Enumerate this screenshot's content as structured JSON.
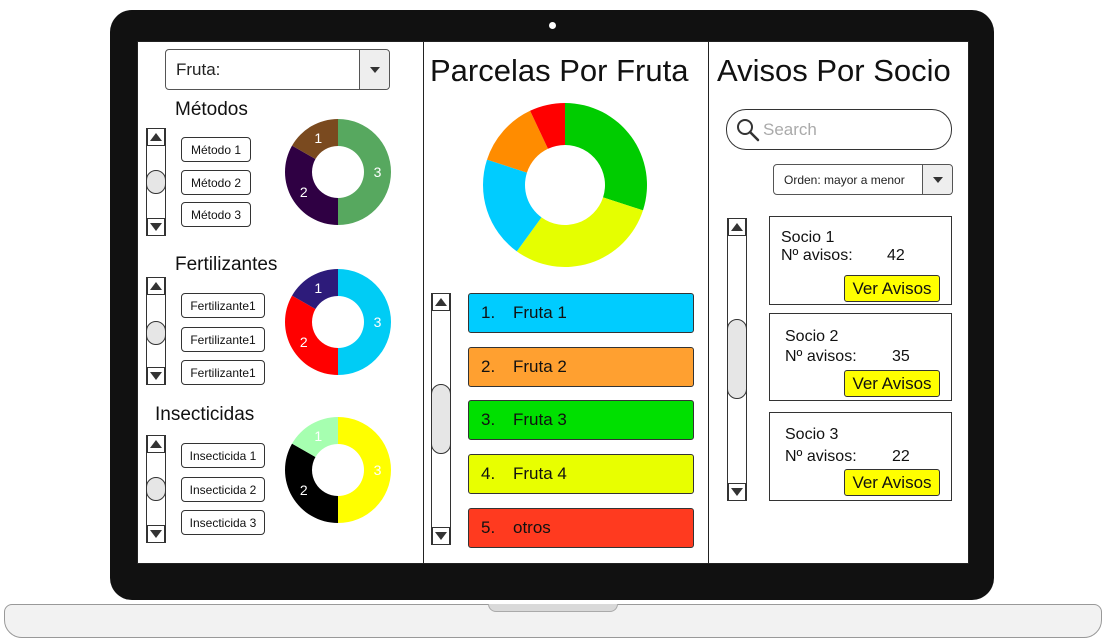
{
  "colors": {
    "metodo": [
      "#57a85f",
      "#2f0043",
      "#7a4a1f"
    ],
    "fertilizante": [
      "#00ccf5",
      "#ff0000",
      "#2d1b7a"
    ],
    "insecticida": [
      "#ffff00",
      "#000000",
      "#a6ffb0"
    ],
    "fruit": [
      "#00cc00",
      "#e5ff00",
      "#00ccff",
      "#ff8c00",
      "#ff0000"
    ],
    "fruit_items": [
      "#00ccff",
      "#ffa030",
      "#00e000",
      "#e8ff00",
      "#ff3a1f"
    ],
    "ver_button": "#ffff00"
  },
  "left": {
    "fruit_select": {
      "value": "Fruta:"
    },
    "metodos": {
      "title": "Métodos",
      "buttons": [
        "Método 1",
        "Método 2",
        "Método 3"
      ],
      "donut": [
        {
          "label": "3",
          "value": 50
        },
        {
          "label": "2",
          "value": 33.3
        },
        {
          "label": "1",
          "value": 16.7
        }
      ]
    },
    "fertilizantes": {
      "title": "Fertilizantes",
      "buttons": [
        "Fertilizante1",
        "Fertilizante1",
        "Fertilizante1"
      ],
      "donut": [
        {
          "label": "3",
          "value": 50
        },
        {
          "label": "2",
          "value": 33.3
        },
        {
          "label": "1",
          "value": 16.7
        }
      ]
    },
    "insecticidas": {
      "title": "Insecticidas",
      "buttons": [
        "Insecticida 1",
        "Insecticida 2",
        "Insecticida 3"
      ],
      "donut": [
        {
          "label": "3",
          "value": 50
        },
        {
          "label": "2",
          "value": 33.3
        },
        {
          "label": "1",
          "value": 16.7
        }
      ]
    }
  },
  "middle": {
    "title": "Parcelas Por Fruta",
    "donut": [
      {
        "value": 30
      },
      {
        "value": 30
      },
      {
        "value": 20
      },
      {
        "value": 13
      },
      {
        "value": 7
      }
    ],
    "items": [
      {
        "num": "1.",
        "label": "Fruta 1"
      },
      {
        "num": "2.",
        "label": "Fruta 2"
      },
      {
        "num": "3.",
        "label": "Fruta 3"
      },
      {
        "num": "4.",
        "label": "Fruta 4"
      },
      {
        "num": "5.",
        "label": "otros"
      }
    ]
  },
  "right": {
    "title": "Avisos Por Socio",
    "search": {
      "placeholder": "Search"
    },
    "order_select": {
      "value": "Orden: mayor a menor"
    },
    "cards": [
      {
        "name": "Socio 1",
        "label": "Nº avisos:",
        "count": "42",
        "button": "Ver Avisos"
      },
      {
        "name": "Socio 2",
        "label": "Nº avisos:",
        "count": "35",
        "button": "Ver Avisos"
      },
      {
        "name": "Socio 3",
        "label": "Nº avisos:",
        "count": "22",
        "button": "Ver Avisos"
      }
    ]
  }
}
